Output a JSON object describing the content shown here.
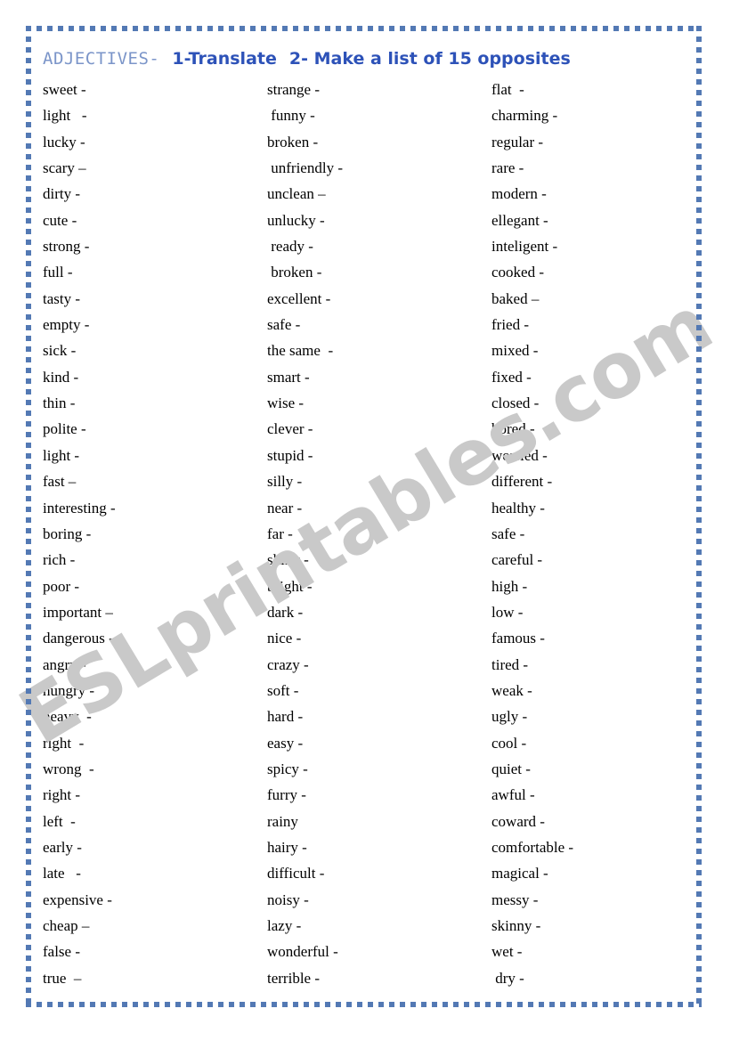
{
  "worksheet": {
    "title_head": "ADJECTIVES-",
    "title_task_1": "1-Translate",
    "title_task_2": "2-  Make a list of 15 opposites",
    "frame_color": "#5379b4",
    "title_head_color": "#7b95c9",
    "title_task_color": "#2d52b8",
    "watermark_text": "ESLprintables.com",
    "watermark_color": "#c9c9c9"
  },
  "columns": [
    {
      "name": "column-1",
      "items": [
        "sweet -",
        "light   -",
        "lucky -",
        "scary –",
        "dirty -",
        "cute -",
        "strong -",
        "full -",
        "tasty -",
        "empty -",
        "sick -",
        "kind -",
        "thin -",
        "polite -",
        "light -",
        "fast –",
        "interesting -",
        "boring -",
        "rich -",
        "poor -",
        "important –",
        "dangerous -",
        "angry -",
        "hungry -",
        "heavy  -",
        "right  -",
        "wrong  -",
        "right -",
        "left  -",
        "early -",
        "late   -",
        "expensive -",
        "cheap –",
        "false -",
        "true  –"
      ]
    },
    {
      "name": "column-2",
      "items": [
        "strange -",
        " funny -",
        "broken -",
        " unfriendly -",
        "unclean –",
        "unlucky -",
        " ready -",
        " broken -",
        "excellent -",
        "safe -",
        "the same  -",
        "smart -",
        "wise -",
        "clever -",
        "stupid -",
        "silly -",
        "near -",
        "far -",
        "shiny -",
        "bright -",
        "dark -",
        "nice -",
        "crazy -",
        "soft -",
        "hard -",
        "easy -",
        "spicy -",
        "furry -",
        "rainy",
        "hairy -",
        "difficult -",
        "noisy -",
        "lazy -",
        "wonderful -",
        "terrible -"
      ]
    },
    {
      "name": "column-3",
      "items": [
        "flat  -",
        "charming -",
        "regular -",
        "rare -",
        "modern -",
        "ellegant -",
        "inteligent -",
        "cooked -",
        "baked –",
        "fried -",
        "mixed -",
        "fixed -",
        "closed -",
        "bored -",
        "worried -",
        "different -",
        "healthy -",
        "safe -",
        "careful -",
        "high -",
        "low -",
        "famous -",
        "tired -",
        "weak -",
        "ugly -",
        "cool -",
        "quiet -",
        "awful -",
        "coward -",
        "comfortable -",
        "magical -",
        "messy -",
        "skinny -",
        "wet -",
        " dry -"
      ]
    }
  ]
}
